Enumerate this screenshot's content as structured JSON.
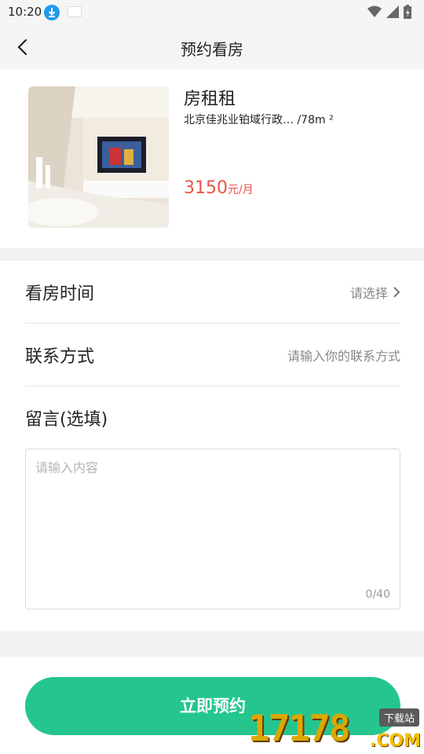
{
  "status_bar": {
    "time": "10:20"
  },
  "nav": {
    "title": "预约看房"
  },
  "listing": {
    "name": "房租租",
    "address": "北京佳兆业铂域行政… /78m ²",
    "price": "3150",
    "price_unit": "元/月"
  },
  "form": {
    "view_time": {
      "label": "看房时间",
      "value": "请选择"
    },
    "contact": {
      "label": "联系方式",
      "placeholder": "请输入你的联系方式"
    },
    "message": {
      "label": "留言(选填)",
      "placeholder": "请输入内容",
      "counter": "0/40"
    }
  },
  "footer": {
    "submit_label": "立即预约"
  },
  "watermark": {
    "digits": "17178",
    "tag": "下载站",
    "suffix": ".COM"
  },
  "colors": {
    "accent": "#24c68e",
    "price": "#e8544a"
  }
}
